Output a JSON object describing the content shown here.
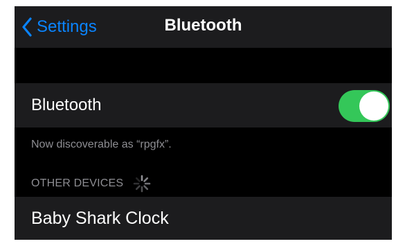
{
  "navbar": {
    "back_label": "Settings",
    "title": "Bluetooth"
  },
  "bluetooth_row": {
    "label": "Bluetooth",
    "toggle_on": true
  },
  "discoverable_text": "Now discoverable as “rpgfx”.",
  "other_devices": {
    "header": "OTHER DEVICES",
    "scanning_icon": "activity-spinner-icon",
    "devices": [
      {
        "name": "Baby Shark Clock"
      }
    ]
  },
  "colors": {
    "accent": "#0a84ff",
    "toggle_on": "#34c759",
    "background": "#000000",
    "cell": "#1c1c1e",
    "secondary_text": "#8e8e93"
  },
  "icons": {
    "back": "chevron-left-icon",
    "toggle_knob": "toggle-knob"
  }
}
